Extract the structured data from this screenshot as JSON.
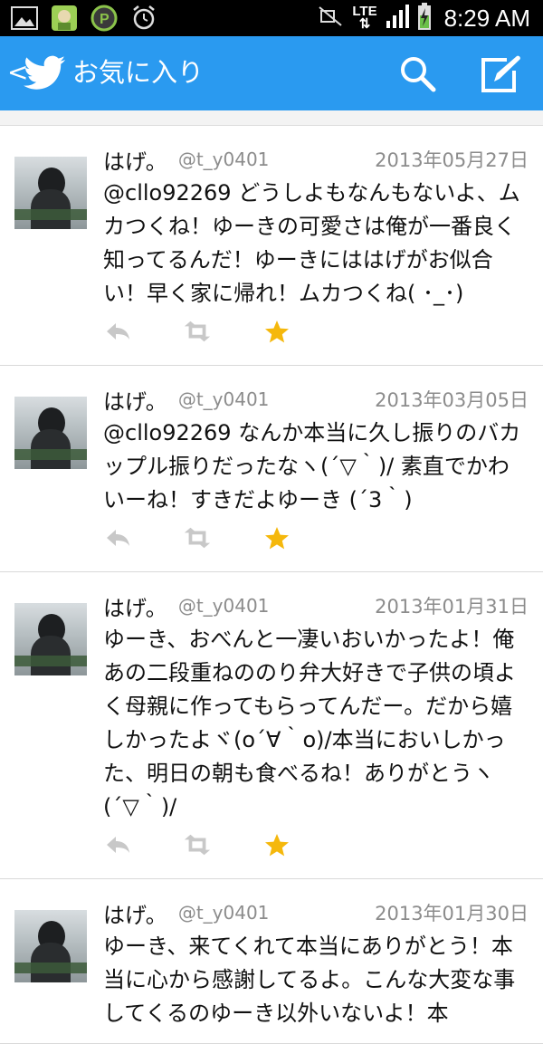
{
  "status_bar": {
    "time": "8:29 AM",
    "network": "LTE",
    "icons": [
      "image-icon",
      "app-icon",
      "parking-app-icon",
      "alarm-icon",
      "mute-icon",
      "signal-icon",
      "battery-charging-icon"
    ]
  },
  "action_bar": {
    "back_glyph": "<",
    "title": "お気に入り",
    "color": "#2a9af0"
  },
  "tweets": [
    {
      "name": "はげ。",
      "handle": "@t_y0401",
      "date": "2013年05月27日",
      "text": "@cllo92269 どうしよもなんもないよ、ムカつくね！ゆーきの可愛さは俺が一番良く知ってるんだ！ゆーきにははげがお似合い！早く家に帰れ！ムカつくね( ･_･)",
      "favorited": true
    },
    {
      "name": "はげ。",
      "handle": "@t_y0401",
      "date": "2013年03月05日",
      "text": "@cllo92269 なんか本当に久し振りのバカップル振りだったなヽ(´▽｀)/ 素直でかわいーね！すきだよゆーき (´3｀)",
      "favorited": true
    },
    {
      "name": "はげ。",
      "handle": "@t_y0401",
      "date": "2013年01月31日",
      "text": "ゆーき、おべんと一凄いおいかったよ！俺あの二段重ねののり弁大好きで子供の頃よく母親に作ってもらってんだー。だから嬉しかったよヾ(o´∀｀o)/本当においしかった、明日の朝も食べるね！ありがとうヽ(´▽｀)/",
      "favorited": true
    },
    {
      "name": "はげ。",
      "handle": "@t_y0401",
      "date": "2013年01月30日",
      "text": "ゆーき、来てくれて本当にありがとう！本当に心から感謝してるよ。こんな大変な事してくるのゆーき以外いないよ！本",
      "favorited": false
    }
  ],
  "colors": {
    "accent": "#2a9af0",
    "favorite_star": "#f5b80c",
    "muted_text": "#8c8c8c"
  }
}
